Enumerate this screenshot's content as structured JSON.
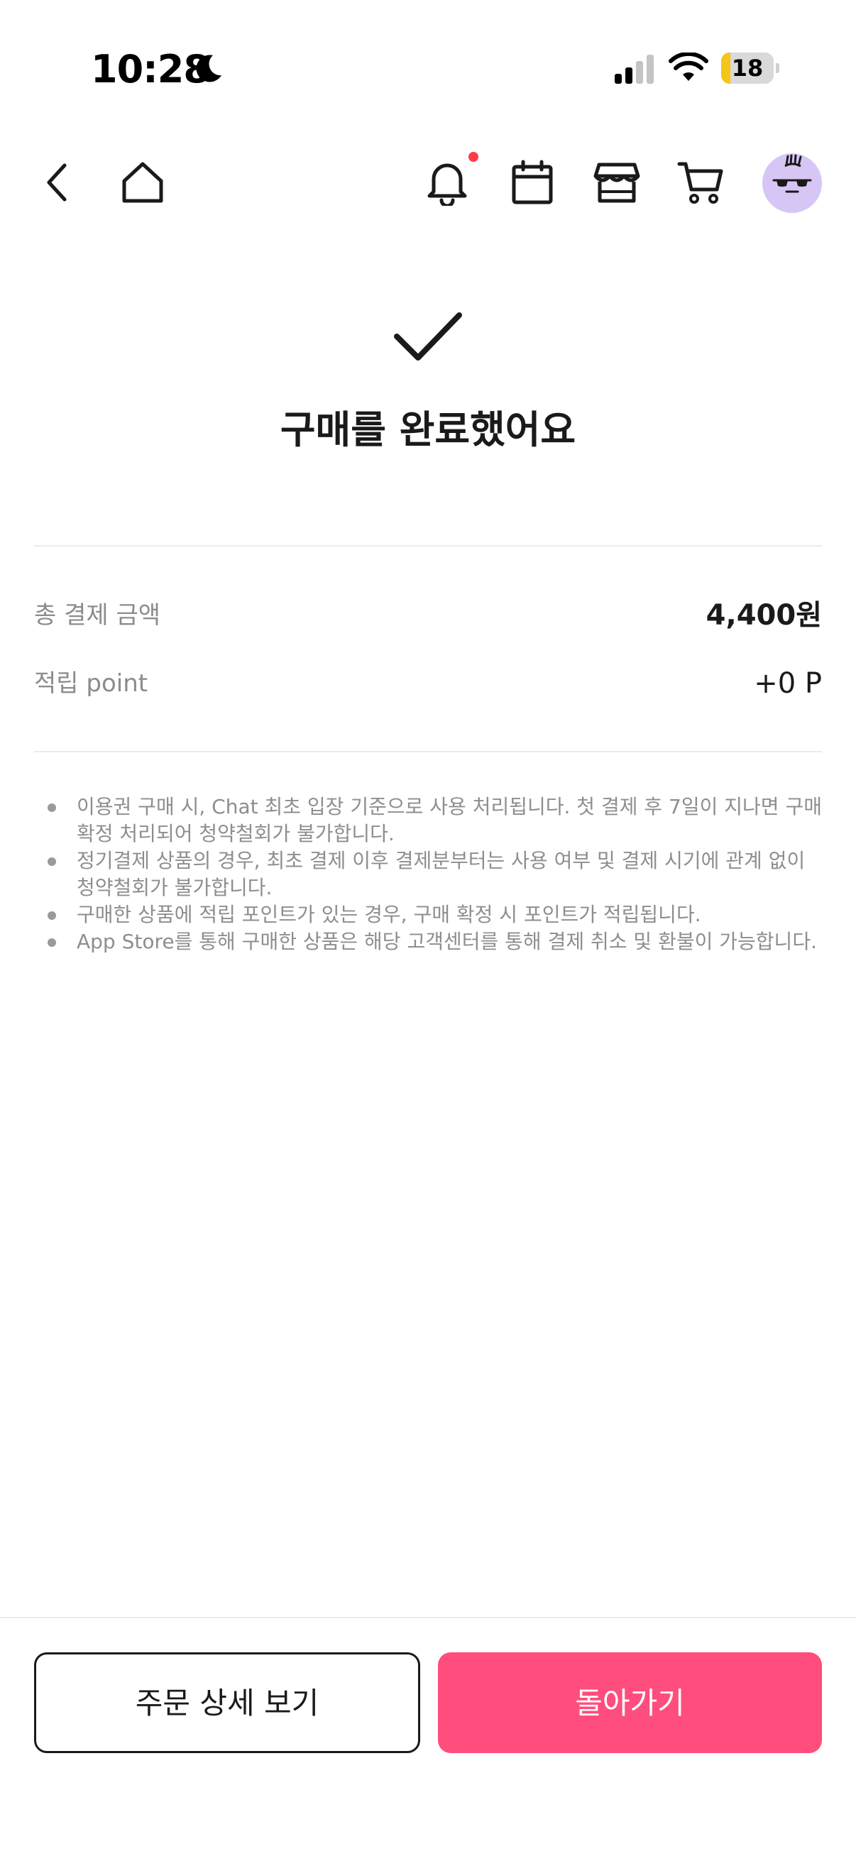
{
  "status_bar": {
    "time": "10:28",
    "battery_level": "18",
    "battery_fraction": 0.18
  },
  "nav": {
    "icons": [
      "chevron-left-icon",
      "home-icon",
      "bell-icon",
      "calendar-icon",
      "store-icon",
      "cart-icon",
      "avatar"
    ],
    "has_notification": true
  },
  "result": {
    "title": "구매를 완료했어요"
  },
  "summary": {
    "total_label": "총 결제 금액",
    "total_value": "4,400원",
    "points_label": "적립 point",
    "points_value": "+0 P"
  },
  "notes": [
    "이용권 구매 시, Chat 최초 입장 기준으로 사용 처리됩니다. 첫 결제 후 7일이 지나면 구매확정 처리되어 청약철회가 불가합니다.",
    "정기결제 상품의 경우, 최초 결제 이후 결제분부터는 사용 여부 및 결제 시기에 관계 없이 청약철회가 불가합니다.",
    "구매한 상품에 적립 포인트가 있는 경우, 구매 확정 시 포인트가 적립됩니다.",
    "App Store를 통해 구매한 상품은 해당 고객센터를 통해 결제 취소 및 환불이 가능합니다."
  ],
  "actions": {
    "order_detail_label": "주문 상세 보기",
    "back_label": "돌아가기"
  },
  "colors": {
    "primary": "#ff4d7d",
    "notification": "#ff3b4a",
    "avatar_bg": "#d7c6f5",
    "battery": "#f5c518"
  }
}
